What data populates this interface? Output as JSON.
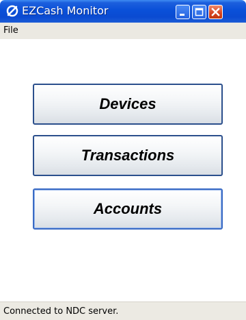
{
  "window": {
    "title": "EZCash Monitor",
    "icons": {
      "app": "app-logo-icon",
      "minimize": "minimize-icon",
      "maximize": "maximize-icon",
      "close": "close-icon"
    }
  },
  "menu": {
    "items": [
      {
        "label": "File"
      }
    ]
  },
  "main": {
    "buttons": [
      {
        "label": "Devices"
      },
      {
        "label": "Transactions"
      },
      {
        "label": "Accounts"
      }
    ]
  },
  "status": {
    "text": "Connected to NDC server."
  },
  "colors": {
    "titlebar": "#0a50d8",
    "button_border": "#2b4f8c",
    "close_button": "#d5421f"
  }
}
